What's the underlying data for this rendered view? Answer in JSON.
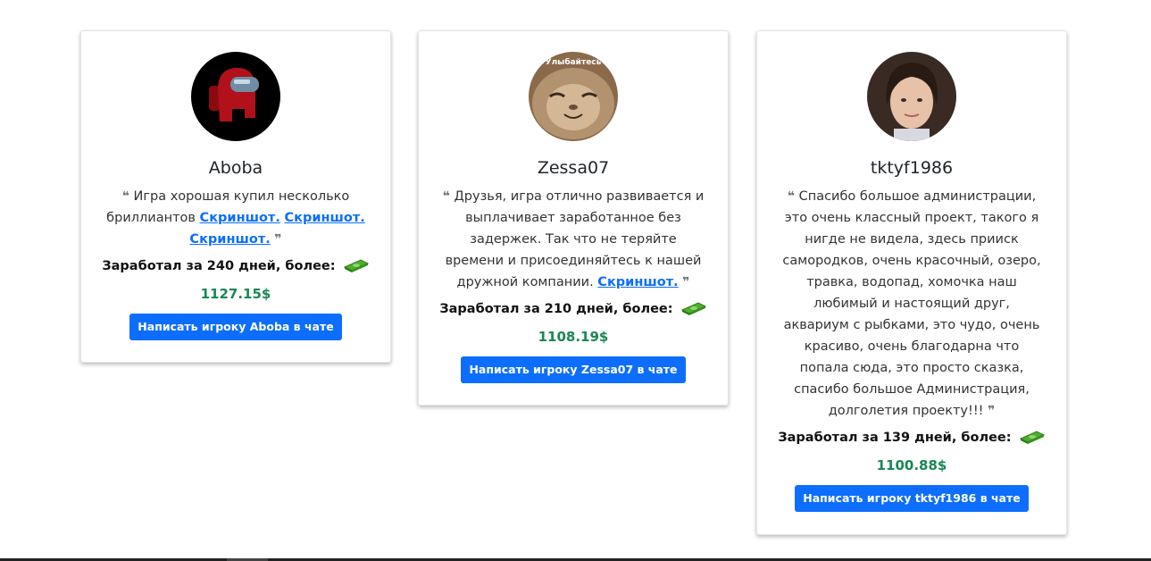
{
  "cards": [
    {
      "name": "Aboba",
      "review_text": "Игра хорошая купил несколько бриллиантов",
      "links": [
        "Скриншот.",
        "Скриншот.",
        "Скриншот."
      ],
      "earned": "Заработал за 240 дней, более:",
      "amount": "1127.15$",
      "button": "Написать игроку Aboba в чате"
    },
    {
      "name": "Zessa07",
      "avatar_caption": "Улыбайтесь",
      "review_text": "Друзья, игра отлично развивается и выплачивает заработанное без задержек. Так что не теряйте времени и присоединяйтесь к нашей дружной компании.",
      "links": [
        "Скриншот."
      ],
      "earned": "Заработал за 210 дней, более:",
      "amount": "1108.19$",
      "button": "Написать игроку Zessa07 в чате"
    },
    {
      "name": "tktyf1986",
      "review_text": "Спасибо большое администрации, это очень классный проект, такого я нигде не видела, здесь прииск самородков, очень красочный, озеро, травка, водопад, хомочка наш любимый и настоящий друг, аквариум с рыбками, это чудо, очень красиво, очень благодарна что попала сюда, это просто сказка, спасибо большое Администрация, долголетия проекту!!!",
      "links": [],
      "earned": "Заработал за 139 дней, более:",
      "amount": "1100.88$",
      "button": "Написать игроку tktyf1986 в чате"
    }
  ],
  "icons": {
    "open_quote": "quote-open-icon",
    "close_quote": "quote-close-icon",
    "money": "money-stack-icon"
  },
  "colors": {
    "accent": "#0d6efd",
    "amount": "#198754",
    "quote": "#6c757d"
  }
}
